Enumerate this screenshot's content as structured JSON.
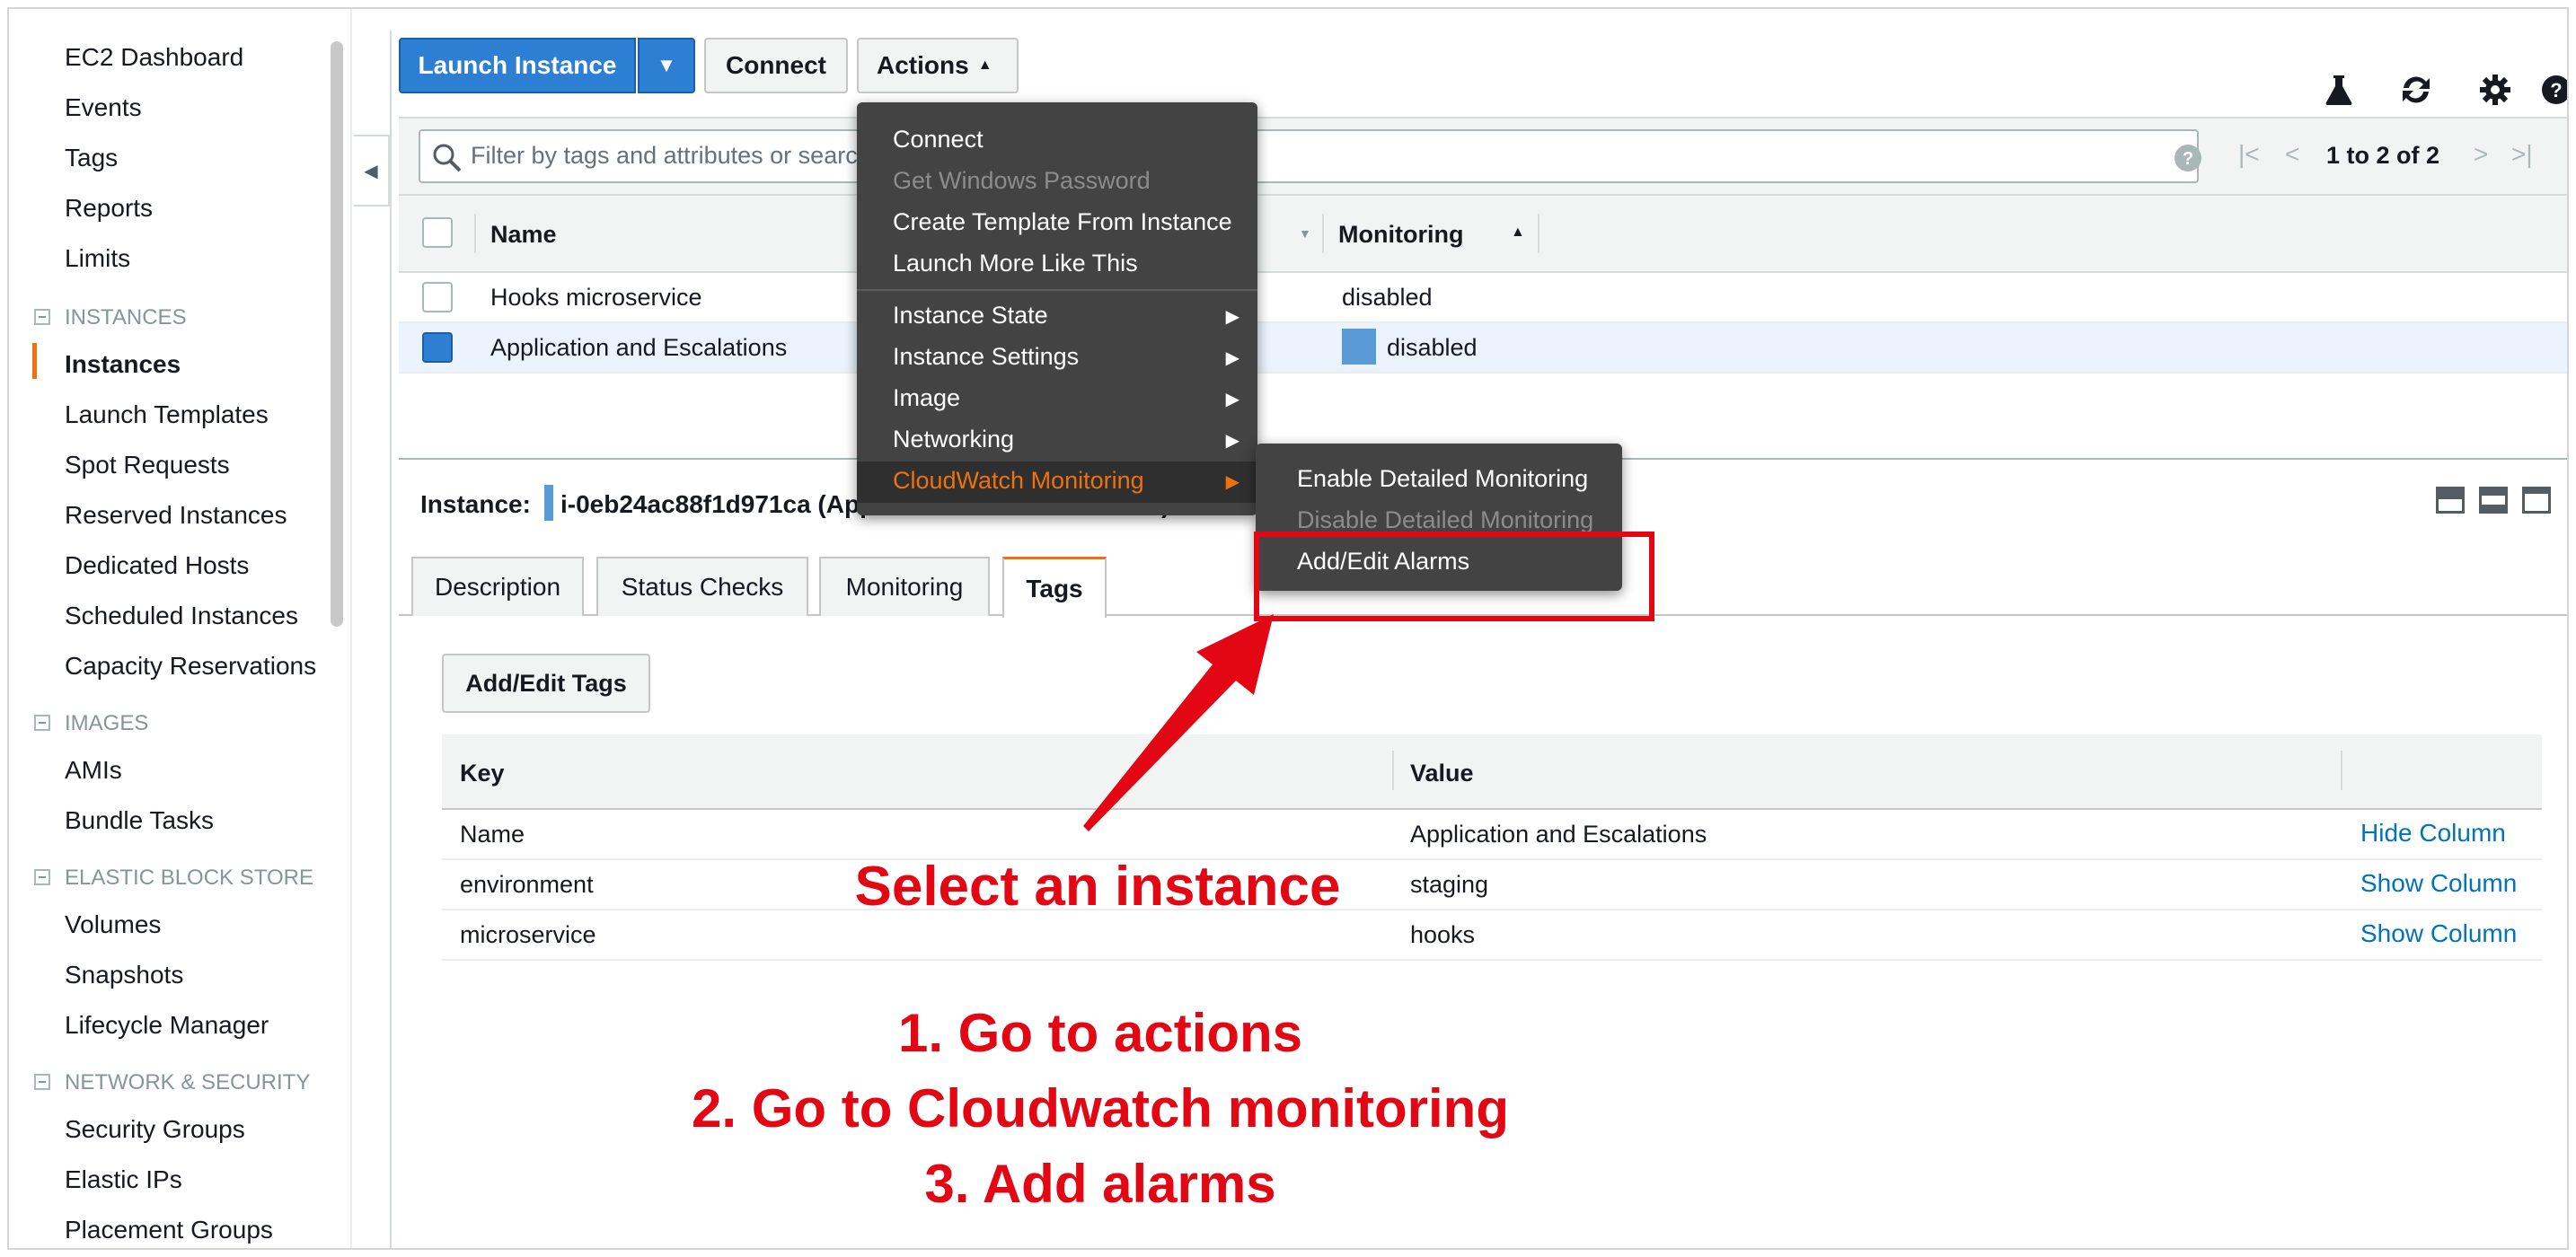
{
  "sidebar": {
    "top_items": [
      "EC2 Dashboard",
      "Events",
      "Tags",
      "Reports",
      "Limits"
    ],
    "sections": [
      {
        "title": "INSTANCES",
        "items": [
          "Instances",
          "Launch Templates",
          "Spot Requests",
          "Reserved Instances",
          "Dedicated Hosts",
          "Scheduled Instances",
          "Capacity Reservations"
        ]
      },
      {
        "title": "IMAGES",
        "items": [
          "AMIs",
          "Bundle Tasks"
        ]
      },
      {
        "title": "ELASTIC BLOCK STORE",
        "items": [
          "Volumes",
          "Snapshots",
          "Lifecycle Manager"
        ]
      },
      {
        "title": "NETWORK & SECURITY",
        "items": [
          "Security Groups",
          "Elastic IPs",
          "Placement Groups"
        ]
      }
    ],
    "active_item": "Instances"
  },
  "toolbar": {
    "launch_label": "Launch Instance",
    "connect_label": "Connect",
    "actions_label": "Actions",
    "icons": [
      "flask-icon",
      "refresh-icon",
      "gear-icon",
      "help-icon"
    ]
  },
  "filter": {
    "placeholder": "Filter by tags and attributes or search by keyword",
    "pager": "1 to 2 of 2"
  },
  "table": {
    "headers": {
      "name": "Name",
      "monitoring": "Monitoring"
    },
    "rows": [
      {
        "name": "Hooks microservice",
        "monitoring": "disabled",
        "selected": false
      },
      {
        "name": "Application and Escalations",
        "monitoring": "disabled",
        "selected": true
      }
    ]
  },
  "detail": {
    "label": "Instance:",
    "instance_id": "i-0eb24ac88f1d971ca (Application and Escalations)",
    "tabs": [
      "Description",
      "Status Checks",
      "Monitoring",
      "Tags"
    ],
    "active_tab": "Tags"
  },
  "tags": {
    "button": "Add/Edit Tags",
    "headers": {
      "key": "Key",
      "value": "Value"
    },
    "rows": [
      {
        "key": "Name",
        "value": "Application and Escalations",
        "action": "Hide Column"
      },
      {
        "key": "environment",
        "value": "staging",
        "action": "Show Column"
      },
      {
        "key": "microservice",
        "value": "hooks",
        "action": "Show Column"
      }
    ]
  },
  "actions_menu": {
    "group1": [
      {
        "label": "Connect",
        "disabled": false
      },
      {
        "label": "Get Windows Password",
        "disabled": true
      },
      {
        "label": "Create Template From Instance",
        "disabled": false
      },
      {
        "label": "Launch More Like This",
        "disabled": false
      }
    ],
    "group2": [
      {
        "label": "Instance State",
        "submenu": true
      },
      {
        "label": "Instance Settings",
        "submenu": true
      },
      {
        "label": "Image",
        "submenu": true
      },
      {
        "label": "Networking",
        "submenu": true
      },
      {
        "label": "CloudWatch Monitoring",
        "submenu": true,
        "highlighted": true
      }
    ]
  },
  "cloudwatch_submenu": [
    {
      "label": "Enable Detailed Monitoring",
      "disabled": false
    },
    {
      "label": "Disable Detailed Monitoring",
      "disabled": true
    },
    {
      "label": "Add/Edit Alarms",
      "disabled": false
    }
  ],
  "annotations": {
    "select_hint": "Select an instance",
    "steps": [
      "1. Go to actions",
      "2. Go to Cloudwatch monitoring",
      "3. Add alarms"
    ],
    "color": "#e30613"
  },
  "colors": {
    "primary_button": "#2d7fd4",
    "accent_orange": "#ec7211",
    "menu_bg": "#434343",
    "link": "#0073bb"
  }
}
